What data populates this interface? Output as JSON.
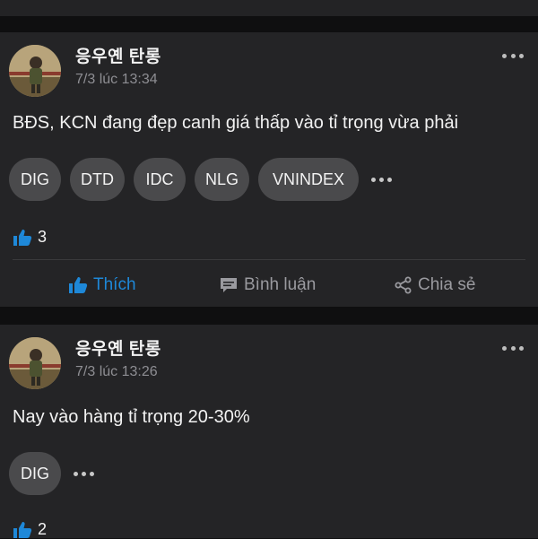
{
  "posts": [
    {
      "author": "응우옌 탄롱",
      "time": "7/3 lúc 13:34",
      "content": "BĐS, KCN đang đẹp canh giá thấp vào tỉ trọng vừa phải",
      "tags": [
        "DIG",
        "DTD",
        "IDC",
        "NLG",
        "VNINDEX"
      ],
      "likes": "3",
      "actions": {
        "like": "Thích",
        "comment": "Bình luận",
        "share": "Chia sẻ"
      }
    },
    {
      "author": "응우옌 탄롱",
      "time": "7/3 lúc 13:26",
      "content": "Nay vào hàng tỉ trọng 20-30%",
      "tags": [
        "DIG"
      ],
      "likes": "2"
    }
  ],
  "colors": {
    "accent": "#1e88d8",
    "card": "#242426",
    "background": "#0f0f10",
    "tag": "#4a4a4c"
  },
  "icons": {
    "like": "thumbs-up-icon",
    "comment": "comment-icon",
    "share": "share-icon",
    "more": "more-horizontal-icon"
  }
}
